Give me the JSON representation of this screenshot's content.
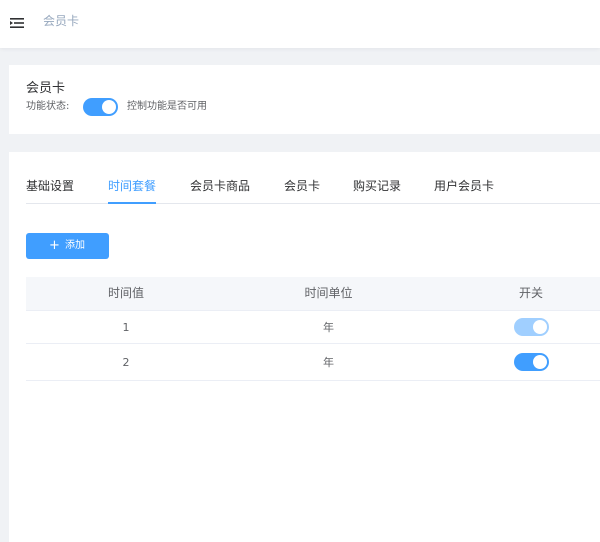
{
  "header": {
    "breadcrumb": "会员卡",
    "menu_icon": "menu-fold-icon"
  },
  "status_card": {
    "title": "会员卡",
    "status_label": "功能状态:",
    "status_on": true,
    "status_hint": "控制功能是否可用"
  },
  "tabs": [
    {
      "label": "基础设置",
      "active": false
    },
    {
      "label": "时间套餐",
      "active": true
    },
    {
      "label": "会员卡商品",
      "active": false
    },
    {
      "label": "会员卡",
      "active": false
    },
    {
      "label": "购买记录",
      "active": false
    },
    {
      "label": "用户会员卡",
      "active": false
    }
  ],
  "add_button": {
    "icon": "plus-icon",
    "label": "添加"
  },
  "table": {
    "columns": [
      "时间值",
      "时间单位",
      "开关"
    ],
    "rows": [
      {
        "value": "1",
        "unit": "年",
        "enabled": true,
        "switch_state": "disabled-on"
      },
      {
        "value": "2",
        "unit": "年",
        "enabled": true,
        "switch_state": "on"
      }
    ]
  },
  "colors": {
    "primary": "#409eff",
    "primary_light": "#a0cfff",
    "background": "#f0f2f5"
  }
}
